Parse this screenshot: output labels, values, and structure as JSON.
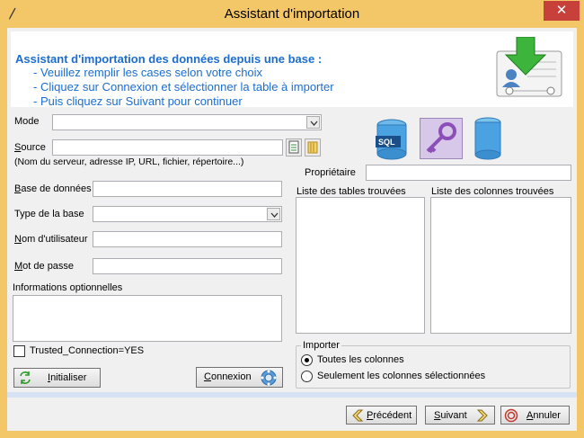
{
  "window": {
    "title": "Assistant d'importation",
    "close_label": "✕",
    "app_icon": "pen-icon"
  },
  "banner": {
    "title": "Assistant d'importation des données depuis une base :",
    "lines": [
      "- Veuillez remplir les cases selon votre choix",
      "- Cliquez sur Connexion et sélectionner la table à importer",
      "- Puis cliquez sur Suivant pour continuer"
    ],
    "image": "import-database-download-icon"
  },
  "form": {
    "mode_label": "Mode",
    "mode_value": "",
    "source_label": "Source",
    "source_value": "",
    "source_hint": "(Nom du serveur, adresse IP, URL, fichier, répertoire...)",
    "database_label": "Base de données",
    "database_value": "",
    "db_type_label": "Type de la base",
    "db_type_value": "",
    "username_label": "Nom d'utilisateur",
    "username_value": "",
    "password_label": "Mot de passe",
    "password_value": "",
    "optional_info_label": "Informations optionnelles",
    "optional_info_value": "",
    "trusted_connection_label": "Trusted_Connection=YES",
    "trusted_connection_checked": false
  },
  "right": {
    "owner_label": "Propriétaire",
    "owner_value": "",
    "tables_label": "Liste des tables trouvées",
    "columns_label": "Liste des colonnes trouvées",
    "import_group_label": "Importer",
    "import_options": [
      {
        "label": "Toutes les colonnes",
        "selected": true
      },
      {
        "label": "Seulement les colonnes sélectionnées",
        "selected": false
      }
    ],
    "db_icons": [
      "sql-database-icon",
      "key-icon",
      "database-cylinder-icon"
    ]
  },
  "buttons": {
    "initialize": "Initialiser",
    "connect": "Connexion",
    "previous": "Précédent",
    "next": "Suivant",
    "cancel": "Annuler"
  },
  "colors": {
    "title_bar": "#f3c768",
    "close_button": "#c7403a",
    "banner_text": "#1c6dd0"
  }
}
